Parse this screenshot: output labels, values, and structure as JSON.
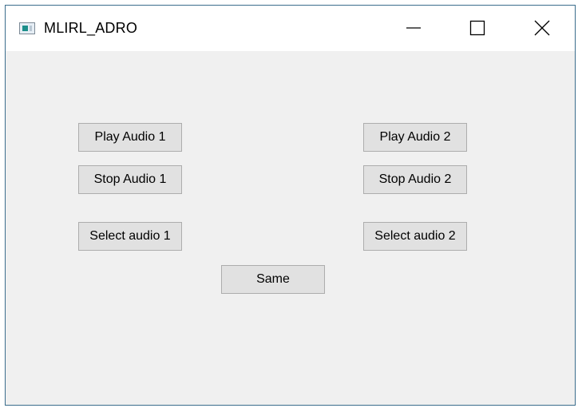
{
  "window": {
    "title": "MLIRL_ADRO",
    "icon": "app-window-icon",
    "controls": {
      "minimize_icon": "minimize-icon",
      "maximize_icon": "maximize-icon",
      "close_icon": "close-icon"
    }
  },
  "buttons": {
    "play_audio_1": "Play Audio 1",
    "stop_audio_1": "Stop Audio 1",
    "select_audio_1": "Select audio 1",
    "play_audio_2": "Play Audio 2",
    "stop_audio_2": "Stop Audio 2",
    "select_audio_2": "Select audio 2",
    "same": "Same"
  },
  "colors": {
    "window_border": "#3a6d8c",
    "client_background": "#f0f0f0",
    "button_face": "#e1e1e1",
    "button_border": "#adadad"
  }
}
